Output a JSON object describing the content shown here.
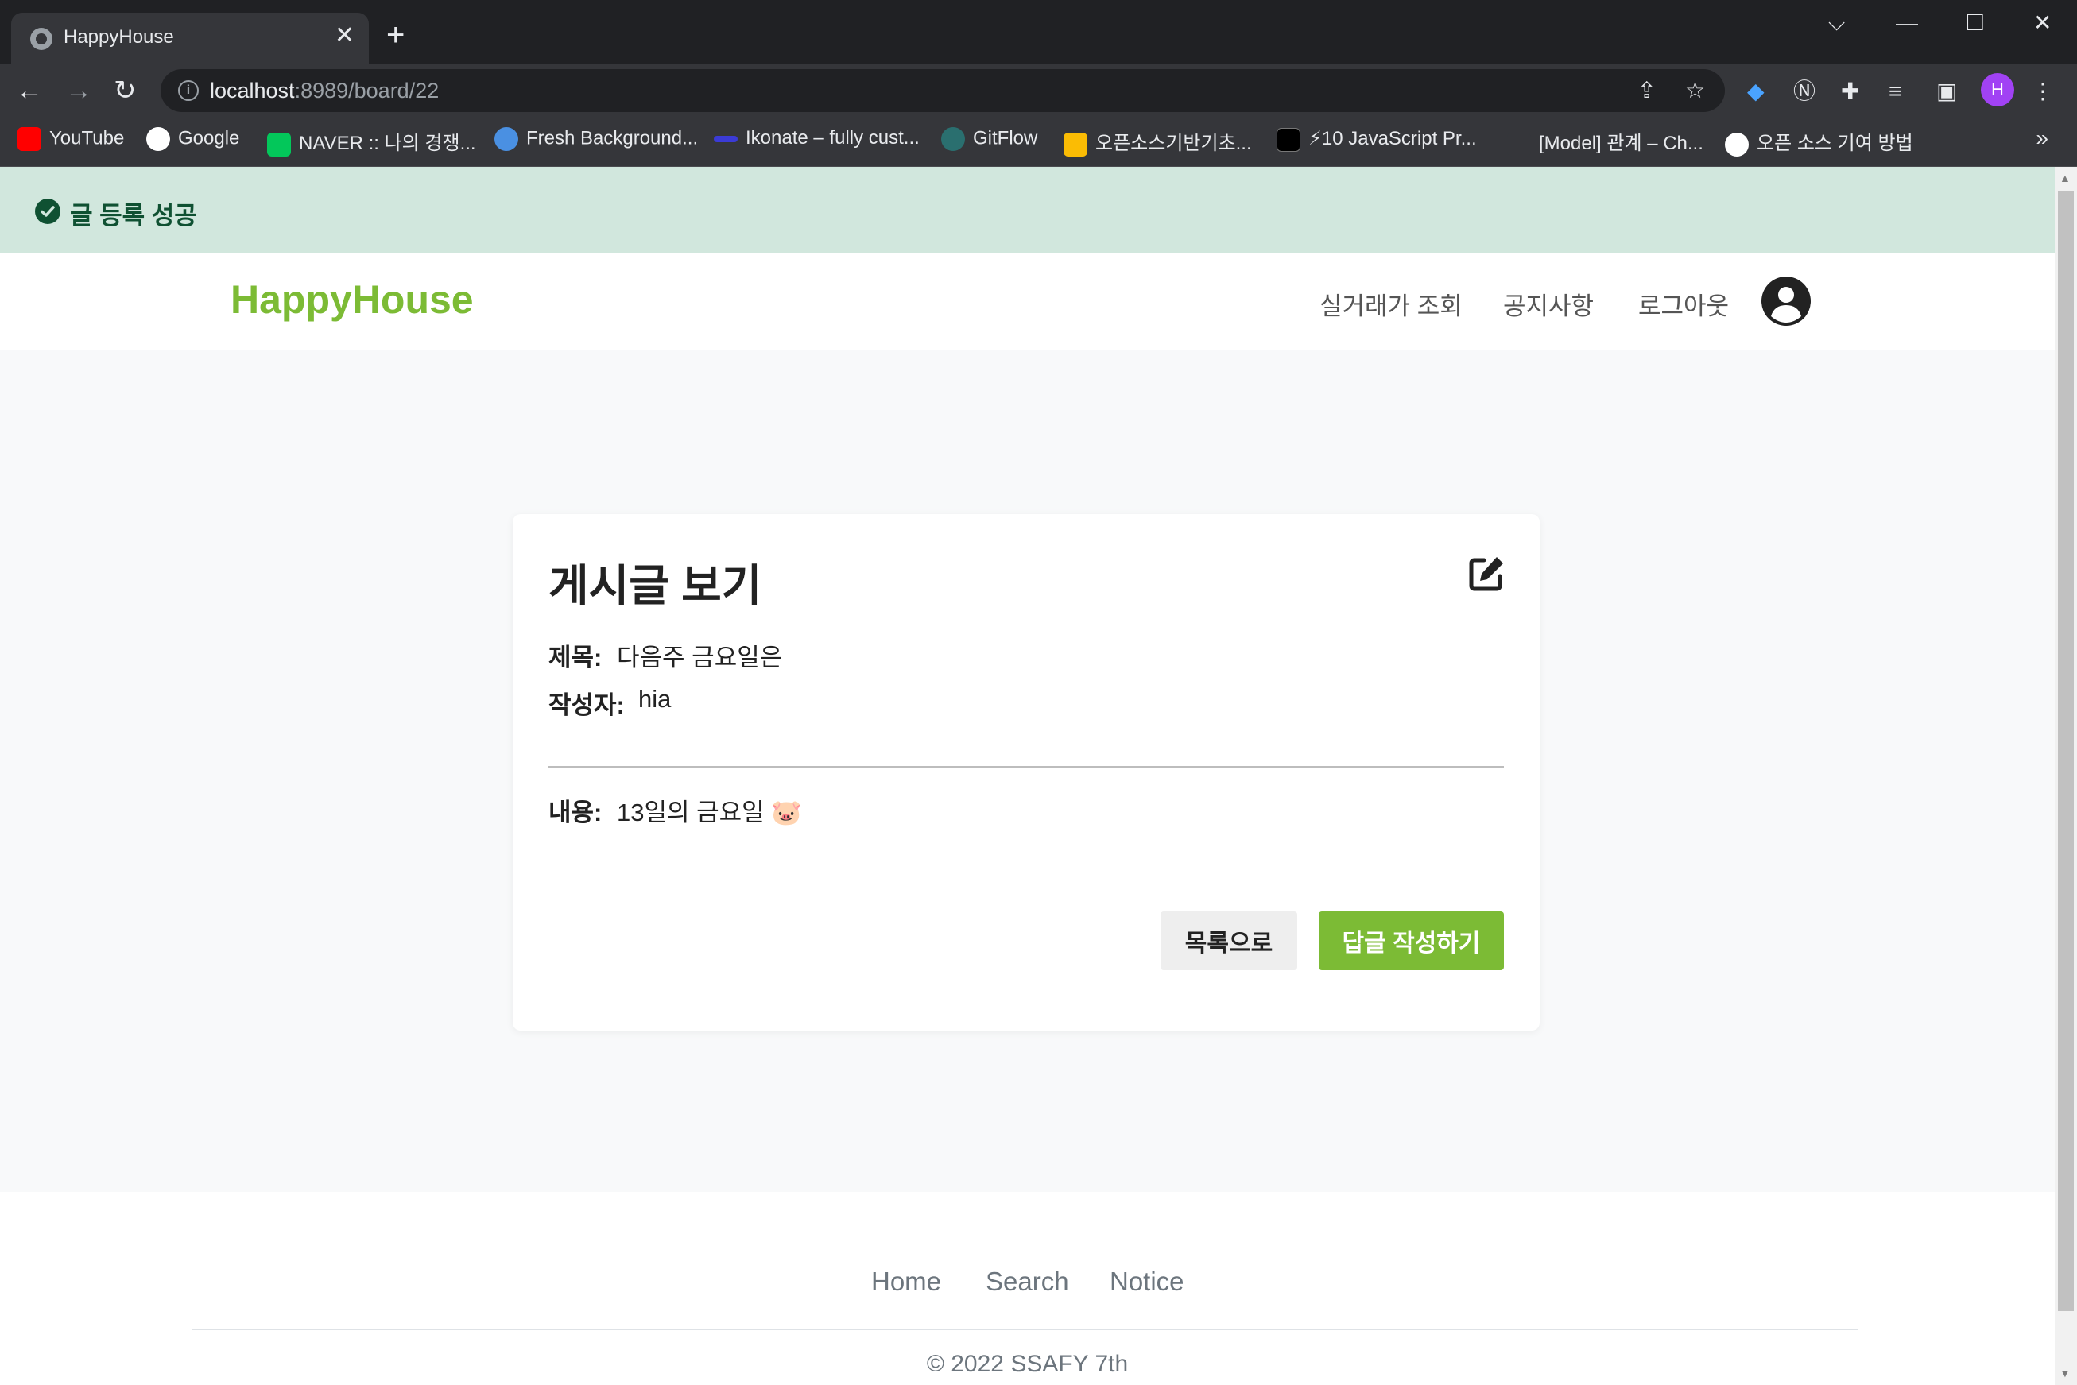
{
  "browser": {
    "tab_title": "HappyHouse",
    "tab_close": "✕",
    "new_tab": "+",
    "url_host": "localhost",
    "url_path": ":8989/board/22",
    "profile_initial": "H",
    "bookmarks": [
      {
        "label": "YouTube",
        "color": "#ff0000"
      },
      {
        "label": "Google",
        "color": "#ffffff"
      },
      {
        "label": "NAVER :: 나의 경쟁...",
        "color": "#03c75a"
      },
      {
        "label": "Fresh Background...",
        "color": "#4a90e2"
      },
      {
        "label": "Ikonate – fully cust...",
        "color": "#3b3bd6"
      },
      {
        "label": "GitFlow",
        "color": "#2a6f6f"
      },
      {
        "label": "오픈소스기반기초...",
        "color": "#fbbc04"
      },
      {
        "label": "⚡10 JavaScript Pr...",
        "color": "#000000"
      },
      {
        "label": "[Model] 관계 – Ch...",
        "color": "#35363a"
      },
      {
        "label": "오픈 소스 기여 방법",
        "color": "#ffffff"
      }
    ],
    "bookmarks_more": "»"
  },
  "alert": {
    "text": "글 등록 성공",
    "color": "#0f5132",
    "bg": "#d1e7dd"
  },
  "navbar": {
    "brand": "HappyHouse",
    "links": [
      "실거래가 조회",
      "공지사항",
      "로그아웃"
    ]
  },
  "post": {
    "heading": "게시글 보기",
    "title_label": "제목:",
    "title_value": "다음주 금요일은",
    "author_label": "작성자:",
    "author_value": "hia",
    "content_label": "내용:",
    "content_value": "13일의 금요일 🐷",
    "list_button": "목록으로",
    "reply_button": "답글 작성하기"
  },
  "footer": {
    "links": [
      "Home",
      "Search",
      "Notice"
    ],
    "copyright": "© 2022 SSAFY 7th"
  },
  "colors": {
    "brand_green": "#7cbb35",
    "chrome_dark": "#202124",
    "chrome_mid": "#35363a"
  }
}
